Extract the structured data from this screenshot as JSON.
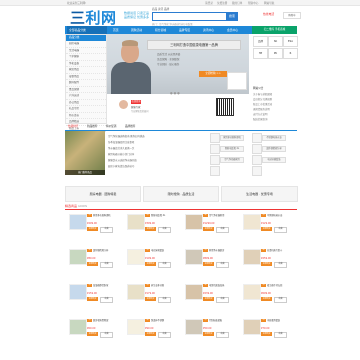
{
  "topbar": {
    "left": "欢迎来到三利网!",
    "links": [
      "请登录",
      "免费注册",
      "我的订单",
      "帮助中心",
      "网站导航"
    ]
  },
  "header": {
    "logo_a": "三",
    "logo_b": "利网",
    "slogan_1": "数据说话 只卖正品",
    "slogan_2": "品质保证 优惠多多",
    "search_tabs": "商品  资讯  品牌",
    "search_placeholder": "",
    "search_button": "搜索",
    "hot_words": "热门：空气净化 净水器 榨汁机 电饭煲",
    "hotline": "热线电话",
    "cart": "购物车"
  },
  "nav": {
    "items": [
      "全部商品分类",
      "首页",
      "团购活动",
      "积分商城",
      "品牌专区",
      "资讯中心",
      "会员中心",
      "专家问答"
    ],
    "right": "扫二维码 手机商城"
  },
  "sidebar": {
    "head": "商品分类",
    "items": [
      "厨房电器",
      "生活电器",
      "个护健康",
      "净化设备",
      "家居用品",
      "母婴用品",
      "数码配件",
      "食品保健",
      "户外运动",
      "办公用品",
      "礼品专区",
      "特价清仓",
      "品牌精选",
      "新品上市"
    ]
  },
  "banner": {
    "title": "三利网打造中国健康电器第一品牌",
    "line1": "品质生活 从这里开始",
    "line2": "正品保障 · 全国联保",
    "line3": "专业团队 · 贴心服务",
    "cta": "立即抢购 >>"
  },
  "right_panel": {
    "brands": [
      "品牌",
      "SK",
      "ESA",
      "HP",
      "PK",
      "R"
    ],
    "notice_head": "网站公告",
    "notices": [
      "关于春节放假通知",
      "会员积分兑换规则",
      "新品上市优惠活动",
      "退换货服务说明",
      "支付方式说明",
      "配送范围查询"
    ]
  },
  "expert": {
    "name": "健康专家",
    "tag": "在线咨询",
    "desc": "专业解答您的疑问"
  },
  "tabs": {
    "items": [
      "热销排行",
      "新品推荐",
      "特价促销",
      "品牌推荐"
    ],
    "list_items": [
      "空气净化器选购指南 教你如何挑选",
      "冬季加湿器使用注意事项",
      "净水器滤芯多久更换一次",
      "家用电器节能小窍门分享",
      "健康饮水从选择净水器开始",
      "厨房小家电清洁保养技巧"
    ],
    "feature_caption": "热门推荐商品"
  },
  "strips": [
    "厨房电器 · 团购特卖",
    "限时抢购 · 品质生活",
    "生活电器 · 优惠专场"
  ],
  "products": {
    "head": "精选商品",
    "sub": "GOODS",
    "cards": [
      {
        "title": "家用多功能料理机",
        "price": "¥299.00",
        "badge": "热"
      },
      {
        "title": "智能电饭煲 4L",
        "price": "¥399.00",
        "badge": "热"
      },
      {
        "title": "空气净化器家用",
        "price": "¥1299.00",
        "badge": "新"
      },
      {
        "title": "不锈钢电热水壶",
        "price": "¥129.00",
        "badge": "热"
      },
      {
        "title": "迷你便携榨汁杯",
        "price": "¥89.00",
        "badge": "新"
      },
      {
        "title": "电动牙刷套装",
        "price": "¥199.00",
        "badge": "热"
      },
      {
        "title": "家用净水器厨房",
        "price": "¥899.00",
        "badge": "热"
      },
      {
        "title": "挂烫机蒸汽熨斗",
        "price": "¥259.00",
        "badge": "新"
      },
      {
        "title": "加湿器静音卧室",
        "price": "¥159.00",
        "badge": "热"
      },
      {
        "title": "养生壶多功能",
        "price": "¥179.00",
        "badge": "热"
      },
      {
        "title": "电饼铛双面加热",
        "price": "¥239.00",
        "badge": "新"
      },
      {
        "title": "吸尘器手持无线",
        "price": "¥699.00",
        "badge": "热"
      },
      {
        "title": "厨房收纳置物架",
        "price": "¥69.00",
        "badge": "热"
      },
      {
        "title": "保温杯不锈钢",
        "price": "¥99.00",
        "badge": "新"
      },
      {
        "title": "竹制砧板菜板",
        "price": "¥59.00",
        "badge": "热"
      },
      {
        "title": "木质餐具套装",
        "price": "¥79.00",
        "badge": "热"
      }
    ],
    "buy_label": "立即购买",
    "fav_label": "收藏"
  },
  "colors": {
    "accent": "#1e88d8",
    "price": "#e33333",
    "orange": "#f08a24",
    "green": "#0aa36a"
  }
}
